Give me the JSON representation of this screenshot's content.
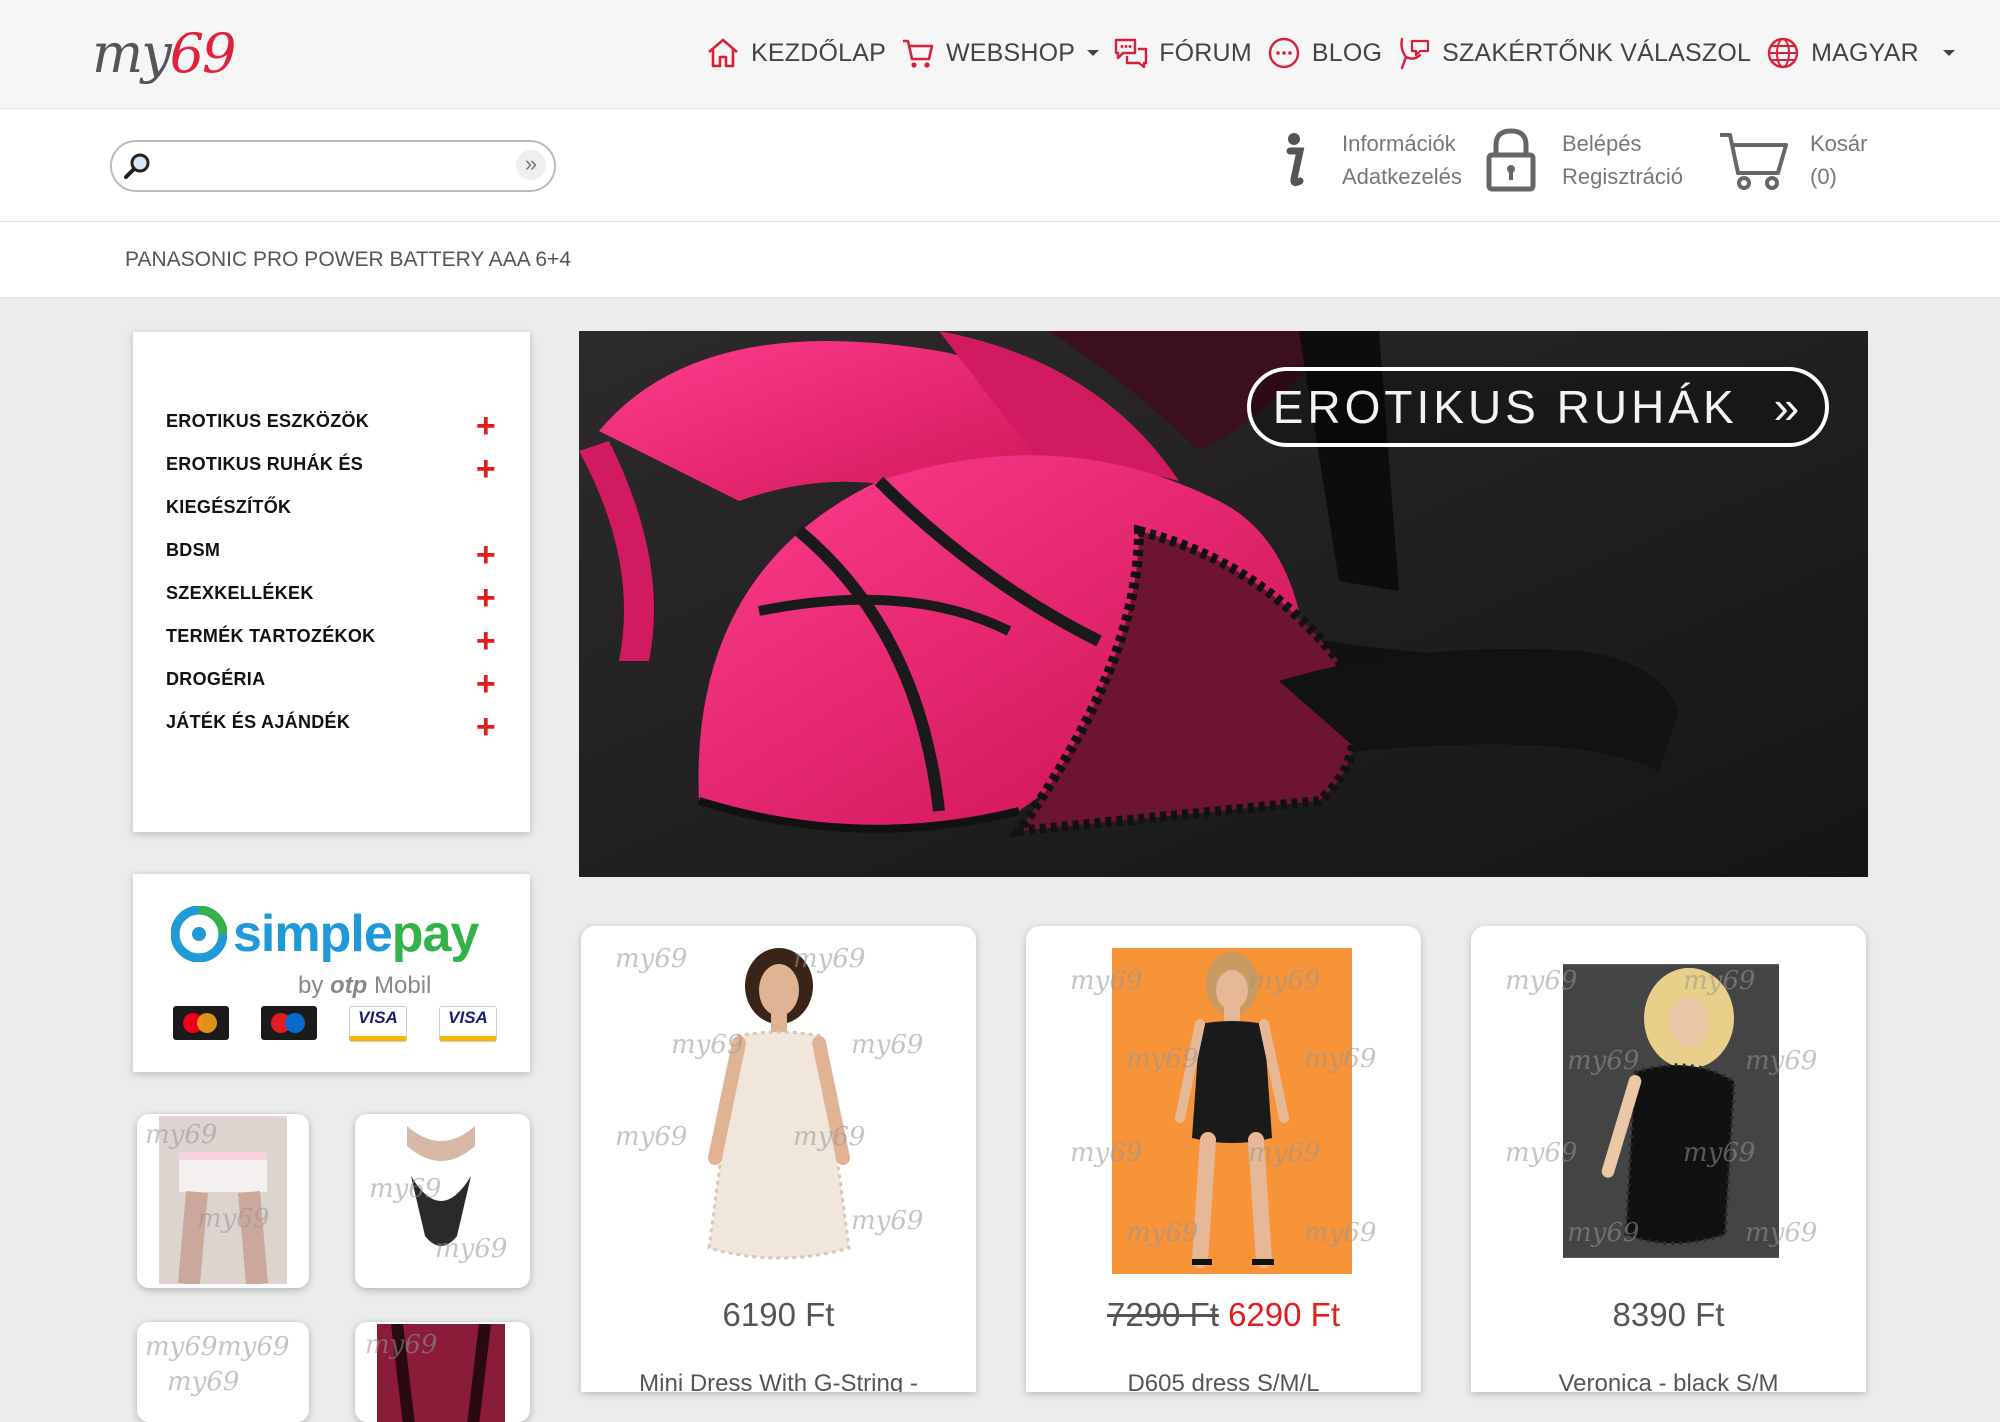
{
  "brand": {
    "logo_text": "my",
    "logo_num": "69"
  },
  "nav": {
    "items": [
      {
        "label": "KEZDŐLAP",
        "icon": "home-icon"
      },
      {
        "label": "WEBSHOP",
        "icon": "cart-icon",
        "dropdown": true
      },
      {
        "label": "FÓRUM",
        "icon": "chat-icon"
      },
      {
        "label": "BLOG",
        "icon": "blog-icon"
      },
      {
        "label": "SZAKÉRTŐNK VÁLASZOL",
        "icon": "expert-icon"
      },
      {
        "label": "MAGYAR",
        "icon": "globe-icon",
        "dropdown": true
      }
    ]
  },
  "search": {
    "placeholder": "",
    "go_label": "»"
  },
  "utility": {
    "info": {
      "line1": "Információk",
      "line2": "Adatkezelés"
    },
    "account": {
      "line1": "Belépés",
      "line2": "Regisztráció"
    },
    "cart": {
      "line1": "Kosár",
      "line2": "(0)"
    }
  },
  "breadcrumb": {
    "text": "PANASONIC PRO POWER BATTERY AAA 6+4"
  },
  "categories": [
    {
      "label": "EROTIKUS ESZKÖZÖK"
    },
    {
      "label": "EROTIKUS RUHÁK ÉS KIEGÉSZÍTŐK"
    },
    {
      "label": "BDSM"
    },
    {
      "label": "SZEXKELLÉKEK"
    },
    {
      "label": "TERMÉK TARTOZÉKOK"
    },
    {
      "label": "DROGÉRIA"
    },
    {
      "label": "JÁTÉK ÉS AJÁNDÉK"
    }
  ],
  "category_toggle": "+",
  "payment": {
    "brand_a": "simple",
    "brand_b": "pay",
    "by": "by",
    "otp": "otp",
    "mobil": "Mobil",
    "cards": [
      "mastercard",
      "maestro",
      "VISA",
      "VISA"
    ]
  },
  "watermark": "my69",
  "banner": {
    "label": "EROTIKUS RUHÁK",
    "arrow": "»"
  },
  "products": [
    {
      "price": "6190 Ft",
      "name": "Mini Dress With G-String -",
      "img_bg": "#ffffff",
      "dress": "#f1e6dc"
    },
    {
      "old_price": "7290 Ft",
      "new_price": "6290 Ft",
      "name": "D605 dress S/M/L",
      "img_bg": "#f7943a",
      "dress": "#1a1a1a"
    },
    {
      "price": "8390 Ft",
      "name": "Veronica - black S/M",
      "img_bg": "#3a3a3a",
      "dress": "#111111"
    }
  ],
  "colors": {
    "accent": "#e31d1d",
    "nav_icon": "#d9203a",
    "simplepay_blue": "#1f9ad6",
    "simplepay_green": "#33b24a"
  }
}
